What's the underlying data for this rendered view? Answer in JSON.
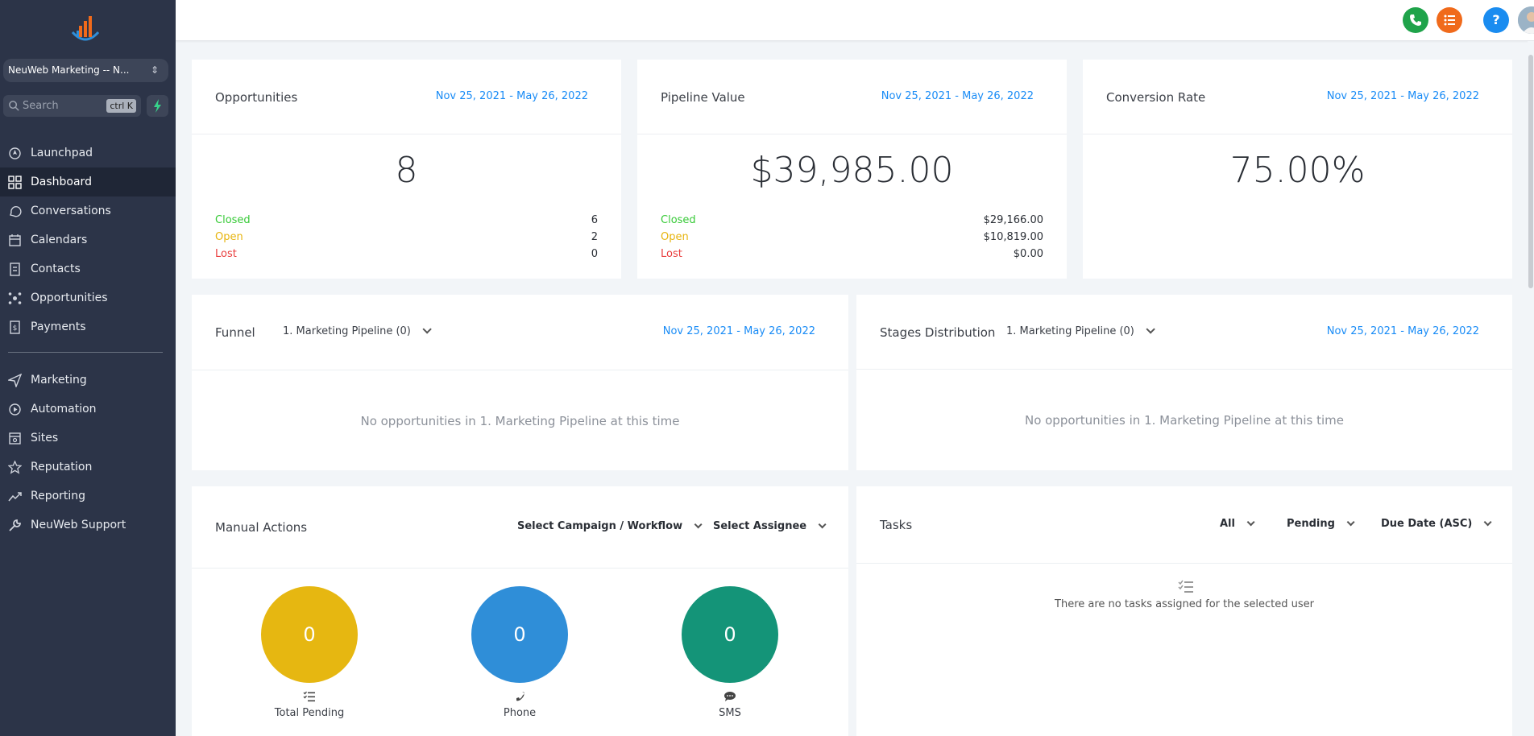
{
  "sidebar": {
    "account_name": "NeuWeb Marketing -- N...",
    "search_placeholder": "Search",
    "search_shortcut": "ctrl K",
    "nav_primary": [
      {
        "label": "Launchpad",
        "icon": "rocket-icon"
      },
      {
        "label": "Dashboard",
        "icon": "dashboard-icon",
        "active": true
      },
      {
        "label": "Conversations",
        "icon": "chat-icon"
      },
      {
        "label": "Calendars",
        "icon": "calendar-icon"
      },
      {
        "label": "Contacts",
        "icon": "contacts-icon"
      },
      {
        "label": "Opportunities",
        "icon": "opportunities-icon"
      },
      {
        "label": "Payments",
        "icon": "payments-icon"
      }
    ],
    "nav_secondary": [
      {
        "label": "Marketing",
        "icon": "send-icon"
      },
      {
        "label": "Automation",
        "icon": "automation-icon"
      },
      {
        "label": "Sites",
        "icon": "sites-icon"
      },
      {
        "label": "Reputation",
        "icon": "star-icon"
      },
      {
        "label": "Reporting",
        "icon": "trend-icon"
      },
      {
        "label": "NeuWeb Support",
        "icon": "wrench-icon"
      }
    ]
  },
  "topbar": {
    "phone_icon": "phone-icon",
    "tasks_icon": "list-icon",
    "help_label": "?",
    "colors": {
      "phone": "#1fa34a",
      "tasks": "#f06a1b",
      "help": "#1a8cf0"
    }
  },
  "opportunities": {
    "title": "Opportunities",
    "date_range": "Nov 25, 2021 - May 26, 2022",
    "total": "8",
    "closed_label": "Closed",
    "closed_value": "6",
    "open_label": "Open",
    "open_value": "2",
    "lost_label": "Lost",
    "lost_value": "0"
  },
  "pipeline_value": {
    "title": "Pipeline Value",
    "date_range": "Nov 25, 2021 - May 26, 2022",
    "total": "$39,985.00",
    "closed_label": "Closed",
    "closed_value": "$29,166.00",
    "open_label": "Open",
    "open_value": "$10,819.00",
    "lost_label": "Lost",
    "lost_value": "$0.00"
  },
  "conversion_rate": {
    "title": "Conversion Rate",
    "date_range": "Nov 25, 2021 - May 26, 2022",
    "total": "75.00%"
  },
  "funnel": {
    "title": "Funnel",
    "pipeline": "1. Marketing Pipeline (0)",
    "date_range": "Nov 25, 2021 - May 26, 2022",
    "empty": "No opportunities in 1. Marketing Pipeline at this time"
  },
  "stages": {
    "title": "Stages Distribution",
    "pipeline": "1. Marketing Pipeline (0)",
    "date_range": "Nov 25, 2021 - May 26, 2022",
    "empty": "No opportunities in 1. Marketing Pipeline at this time"
  },
  "manual_actions": {
    "title": "Manual Actions",
    "campaign_select": "Select Campaign / Workflow",
    "assignee_select": "Select Assignee",
    "items": [
      {
        "value": "0",
        "label": "Total Pending",
        "color": "#e6b711",
        "icon": "checklist-icon"
      },
      {
        "value": "0",
        "label": "Phone",
        "color": "#2f8ed8",
        "icon": "phone-icon"
      },
      {
        "value": "0",
        "label": "SMS",
        "color": "#149478",
        "icon": "sms-icon"
      }
    ]
  },
  "tasks": {
    "title": "Tasks",
    "filter_all": "All",
    "filter_status": "Pending",
    "filter_sort": "Due Date (ASC)",
    "empty": "There are no tasks assigned for the selected user"
  }
}
